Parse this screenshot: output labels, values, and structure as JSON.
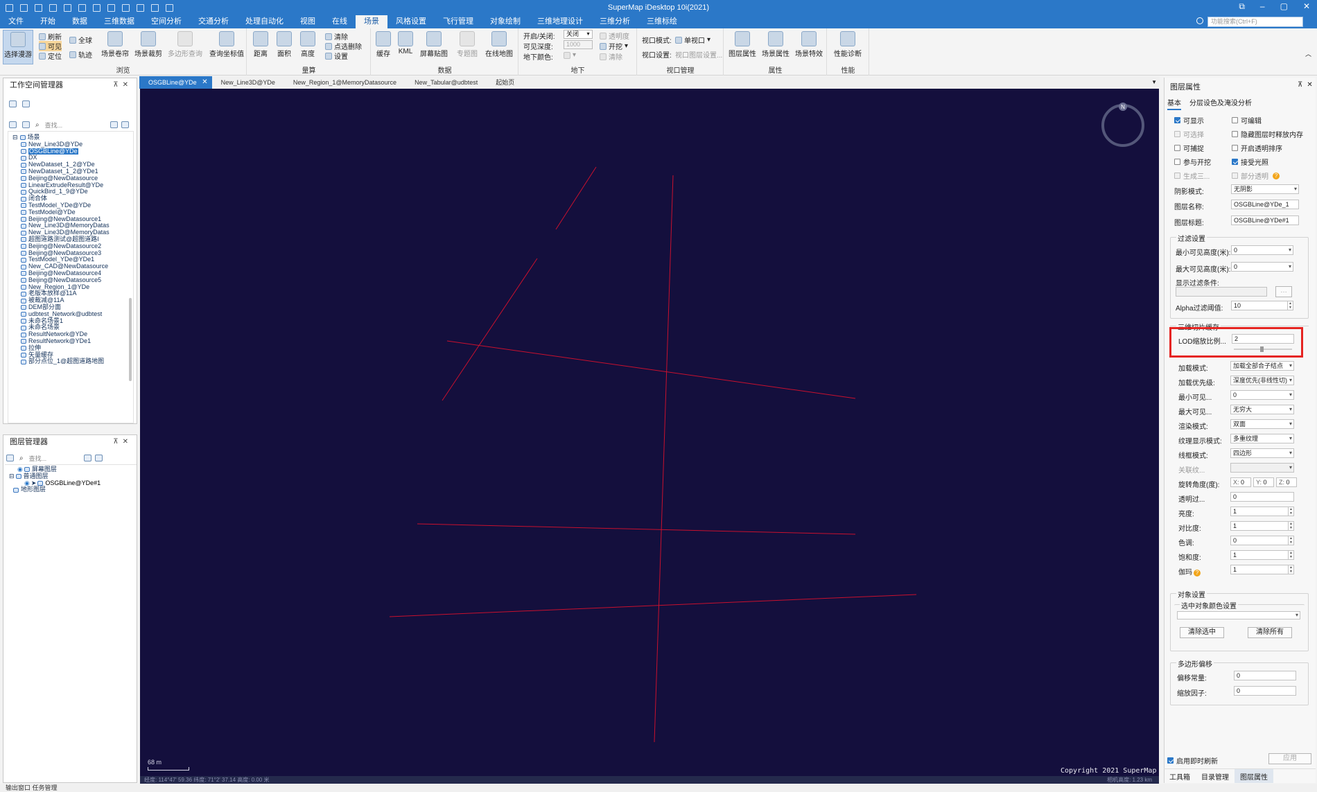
{
  "app": {
    "title": "SuperMap iDesktop 10i(2021)",
    "search_placeholder": "功能搜索(Ctrl+F)"
  },
  "menu": [
    "文件",
    "开始",
    "数据",
    "三维数据",
    "空间分析",
    "交通分析",
    "处理自动化",
    "视图",
    "在线",
    "场景",
    "风格设置",
    "飞行管理",
    "对象绘制",
    "三维地理设计",
    "三维分析",
    "三维标绘"
  ],
  "menu_active": "场景",
  "ribbon": {
    "browse": {
      "label": "浏览",
      "select_roam": "选择漫游",
      "refresh": "刷新",
      "globe": "全球",
      "visible": "可见",
      "track": "轨迹",
      "locate": "定位",
      "scene_roll": "场景卷帘",
      "scene_clip": "场景裁剪",
      "polygon_query": "多边形查询",
      "query_coord": "查询坐标值"
    },
    "measure": {
      "label": "量算",
      "distance": "距离",
      "area": "面积",
      "height": "高度",
      "clear": "清除",
      "pick_delete": "点选删除",
      "settings": "设置"
    },
    "data": {
      "label": "数据",
      "cache": "缓存",
      "kml": "KML",
      "screen_paste": "屏幕贴图",
      "thematic": "专题图",
      "online_map": "在线地图"
    },
    "underground": {
      "label": "地下",
      "on_off_label": "开启/关闭:",
      "on_off_value": "关闭",
      "depth_label": "可见深度:",
      "depth_value": "1000",
      "color_label": "地下颜色:",
      "transparency": "透明度",
      "excavate": "开挖",
      "clear": "清除"
    },
    "viewport": {
      "label": "视口管理",
      "mode_label": "视口模式:",
      "mode_value": "单视口",
      "settings_label": "视口设置:",
      "settings_value": "视口图层设置..."
    },
    "properties": {
      "label": "属性",
      "layer_prop": "图层属性",
      "scene_prop": "场景属性",
      "scene_effects": "场景特效"
    },
    "performance": {
      "label": "性能",
      "diagnose": "性能诊断"
    }
  },
  "workspace": {
    "title": "工作空间管理器",
    "search": "查找...",
    "root": "场景",
    "items": [
      "New_Line3D@YDe",
      "OSGBLine@YDe",
      "DX",
      "NewDataset_1_2@YDe",
      "NewDataset_1_2@YDe1",
      "Beijing@NewDatasource",
      "LinearExtrudeResult@YDe",
      "QuickBird_1_9@YDe",
      "闭合体",
      "TestModel_YDe@YDe",
      "TestModel@YDe",
      "Beijing@NewDatasource1",
      "New_Line3D@MemoryDatas",
      "New_Line3D@MemoryDatas",
      "超图道路测试@超图道路I",
      "Beijing@NewDatasource2",
      "Beijing@NewDatasource3",
      "TestModel_YDe@YDe1",
      "New_CAD@NewDatasource",
      "Beijing@NewDatasource4",
      "Beijing@NewDatasource5",
      "New_Region_1@YDe",
      "老版本放样@11A",
      "被裁减@11A",
      "DEM部分面",
      "udbtest_Network@udbtest",
      "未命名场景1",
      "未命名场景",
      "ResultNetwork@YDe",
      "ResultNetwork@YDe1",
      "拉伸",
      "矢量缓存",
      "部分点位_1@超图道路地图"
    ],
    "selected_index": 1
  },
  "layers": {
    "title": "图层管理器",
    "search": "查找...",
    "screen": "屏幕图层",
    "normal": "普通图层",
    "layer": "OSGBLine@YDe#1",
    "terrain": "地形图层"
  },
  "tabs": [
    "OSGBLine@YDe",
    "New_Line3D@YDe",
    "New_Region_1@MemoryDatasource",
    "New_Tabular@udbtest",
    "起始页"
  ],
  "tabs_active": 0,
  "viewport": {
    "copyright": "Copyright 2021 SuperMap",
    "scale": "68 m",
    "compass": "N",
    "status": "经度: 114°47'    59.36    纬度: 71°2'    37.14    高度: 0.00 米",
    "status_right": "相机高度: 1.23 km",
    "line_color": "#c8102e"
  },
  "props": {
    "title": "图层属性",
    "tabs": [
      "基本",
      "分层设色及淹没分析"
    ],
    "checkboxes": [
      {
        "label": "可显示",
        "checked": true,
        "disabled": false
      },
      {
        "label": "可编辑",
        "checked": false,
        "disabled": false
      },
      {
        "label": "可选择",
        "checked": false,
        "disabled": true
      },
      {
        "label": "隐藏图层时释放内存",
        "checked": false,
        "disabled": false
      },
      {
        "label": "可捕捉",
        "checked": false,
        "disabled": false
      },
      {
        "label": "开启透明排序",
        "checked": false,
        "disabled": false
      },
      {
        "label": "参与开挖",
        "checked": false,
        "disabled": false
      },
      {
        "label": "接受光照",
        "checked": true,
        "disabled": false
      },
      {
        "label": "生成三...",
        "checked": false,
        "disabled": true
      },
      {
        "label": "部分透明",
        "checked": false,
        "disabled": true
      }
    ],
    "shadow_label": "阴影模式:",
    "shadow_value": "无阴影",
    "name_label": "图层名称:",
    "name_value": "OSGBLine@YDe_1",
    "caption_label": "图层标题:",
    "caption_value": "OSGBLine@YDe#1",
    "filter_group": "过滤设置",
    "min_height_label": "最小可见高度(米):",
    "min_height_value": "0",
    "max_height_label": "最大可见高度(米):",
    "max_height_value": "0",
    "display_filter_label": "显示过滤条件:",
    "alpha_label": "Alpha过滤阈值:",
    "alpha_value": "10",
    "cache_group": "三维切片缓存",
    "lod_label": "LOD缩放比例...",
    "lod_value": "2",
    "load_mode_label": "加载模式:",
    "load_mode_value": "加载全部合子结点",
    "load_priority_label": "加载优先级:",
    "load_priority_value": "深度优先(非线性切)",
    "min_visible_label": "最小可见...",
    "min_visible_value": "0",
    "max_visible_label": "最大可见...",
    "max_visible_value": "无穷大",
    "render_label": "渲染模式:",
    "render_value": "双面",
    "texture_label": "纹理显示模式:",
    "texture_value": "多重纹理",
    "wireframe_label": "线框模式:",
    "wireframe_value": "四边形",
    "assoc_label": "关联纹...",
    "rotation_label": "旋转角度(度):",
    "rot_x_label": "X:",
    "rot_x": "0",
    "rot_y_label": "Y:",
    "rot_y": "0",
    "rot_z_label": "Z:",
    "rot_z": "0",
    "transparency_label": "透明过...",
    "transparency_value": "0",
    "brightness_label": "亮度:",
    "brightness_value": "1",
    "contrast_label": "对比度:",
    "contrast_value": "1",
    "hue_label": "色调:",
    "hue_value": "0",
    "saturation_label": "饱和度:",
    "saturation_value": "1",
    "gamma_label": "伽玛",
    "gamma_value": "1",
    "object_group": "对象设置",
    "sel_color_group": "选中对象颜色设置",
    "clear_selected": "清除选中",
    "clear_all": "清除所有",
    "offset_group": "多边形偏移",
    "offset_const_label": "偏移常量:",
    "offset_const_value": "0",
    "scale_factor_label": "缩放因子:",
    "scale_factor_value": "0",
    "instant_refresh": "启用即时刷新",
    "apply": "应用"
  },
  "bottom_tabs": [
    "工具箱",
    "目录管理",
    "图层属性"
  ],
  "bottom_active": 2,
  "footer": "输出窗口    任务管理"
}
